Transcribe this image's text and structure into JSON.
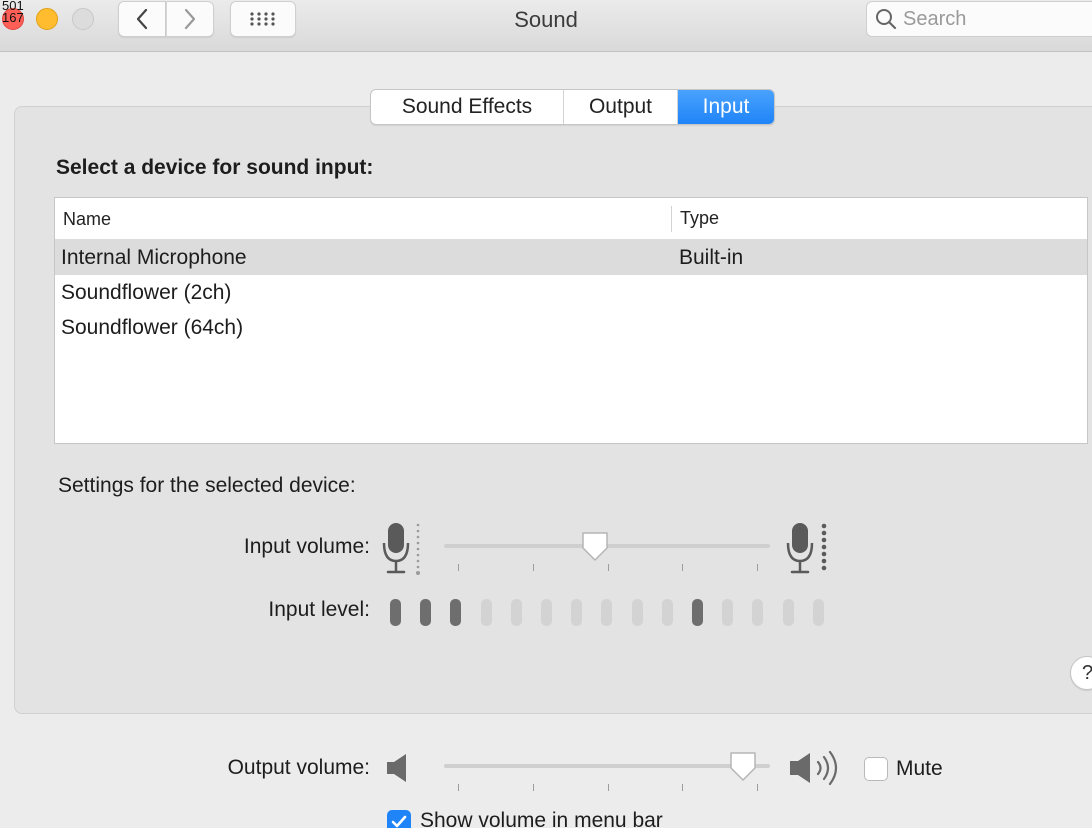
{
  "titlebar": {
    "badge_line1": "501",
    "badge_line2": "167",
    "title": "Sound",
    "search_placeholder": "Search"
  },
  "tabs": [
    {
      "label": "Sound Effects",
      "active": false
    },
    {
      "label": "Output",
      "active": false
    },
    {
      "label": "Input",
      "active": true
    }
  ],
  "input_section": {
    "title": "Select a device for sound input:",
    "columns": [
      "Name",
      "Type"
    ],
    "devices": [
      {
        "name": "Internal Microphone",
        "type": "Built-in",
        "selected": true
      },
      {
        "name": "Soundflower (2ch)",
        "type": "",
        "selected": false
      },
      {
        "name": "Soundflower (64ch)",
        "type": "",
        "selected": false
      }
    ]
  },
  "settings": {
    "label": "Settings for the selected device:",
    "input_volume_label": "Input volume:",
    "input_volume_level": 0.46,
    "input_level_label": "Input level:",
    "input_level_bars": 15,
    "input_level_lit": [
      0,
      1,
      2,
      10
    ]
  },
  "help_label": "?",
  "output": {
    "volume_label": "Output volume:",
    "volume_level": 0.96,
    "mute_label": "Mute",
    "mute_checked": false,
    "show_in_menu_label": "Show volume in menu bar",
    "show_in_menu_checked": true
  },
  "icons": {
    "back": "chevron-left-icon",
    "forward": "chevron-right-icon",
    "grid": "grid-icon",
    "search": "magnifier-icon",
    "mic_low": "microphone-low-icon",
    "mic_high": "microphone-high-icon",
    "speaker_low": "speaker-low-icon",
    "speaker_high": "speaker-high-icon"
  },
  "colors": {
    "accent": "#1f84f7",
    "close": "#ff5f57",
    "minimize": "#febc2e",
    "selected_row": "#dcdcdc"
  }
}
